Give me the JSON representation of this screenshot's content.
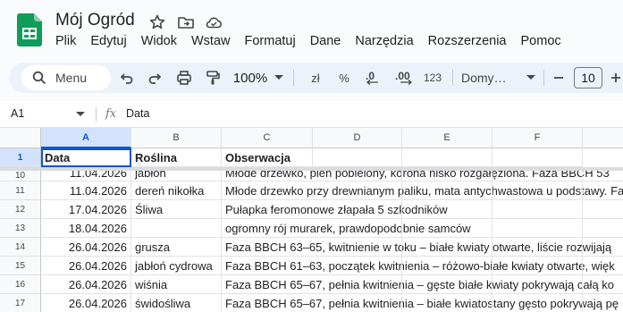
{
  "app": {
    "title": "Mój Ogród",
    "menu": [
      "Plik",
      "Edytuj",
      "Widok",
      "Wstaw",
      "Formatuj",
      "Dane",
      "Narzędzia",
      "Rozszerzenia",
      "Pomoc"
    ]
  },
  "toolbar": {
    "menu_label": "Menu",
    "zoom": "100%",
    "currency": "zł",
    "percent": "%",
    "dec_decrease": ".0",
    "dec_increase": ".00",
    "number_format": "123",
    "font": "Domy…",
    "font_size": "10"
  },
  "formula_bar": {
    "cell_ref": "A1",
    "fx": "fx",
    "content": "Data"
  },
  "grid": {
    "columns": [
      "A",
      "B",
      "C",
      "D",
      "E",
      "F"
    ],
    "header_row": {
      "num": "1",
      "cells": [
        "Data",
        "Roślina",
        "Obserwacja"
      ]
    },
    "partial_row": {
      "num": "10",
      "cells": [
        "11.04.2026",
        "jabłoń",
        "Młode drzewko, pień pobielony, korona nisko rozgałęziona. Faza BBCH 53"
      ]
    },
    "rows": [
      {
        "num": "11",
        "cells": [
          "11.04.2026",
          "dereń nikołka",
          "Młode drzewko przy drewnianym paliku, mata antychwastowa u podstawy. Fa"
        ]
      },
      {
        "num": "12",
        "cells": [
          "17.04.2026",
          "Śliwa",
          "Pułapka feromonowe złapała 5 szkodników"
        ]
      },
      {
        "num": "13",
        "cells": [
          "18.04.2026",
          "",
          "ogromny rój murarek, prawdopodobnie samców"
        ]
      },
      {
        "num": "14",
        "cells": [
          "26.04.2026",
          "grusza",
          "Faza BBCH 63–65, kwitnienie w toku – białe kwiaty otwarte, liście rozwijają"
        ]
      },
      {
        "num": "15",
        "cells": [
          "26.04.2026",
          "jabłoń cydrowa",
          "Faza BBCH 61–63, początek kwitnienia – różowo-białe kwiaty otwarte, więk"
        ]
      },
      {
        "num": "16",
        "cells": [
          "26.04.2026",
          "wiśnia",
          "Faza BBCH 65–67, pełnia kwitnienia – gęste białe kwiaty pokrywają całą ko"
        ]
      },
      {
        "num": "17",
        "cells": [
          "26.04.2026",
          "świdośliwa",
          "Faza BBCH 65–67, pełnia kwitnienia – białe kwiatostany gęsto pokrywają pę"
        ]
      }
    ]
  },
  "colors": {
    "accent": "#0b57d0",
    "sheets_green": "#0f9d58",
    "toolbar_bg": "#edf2fa"
  }
}
